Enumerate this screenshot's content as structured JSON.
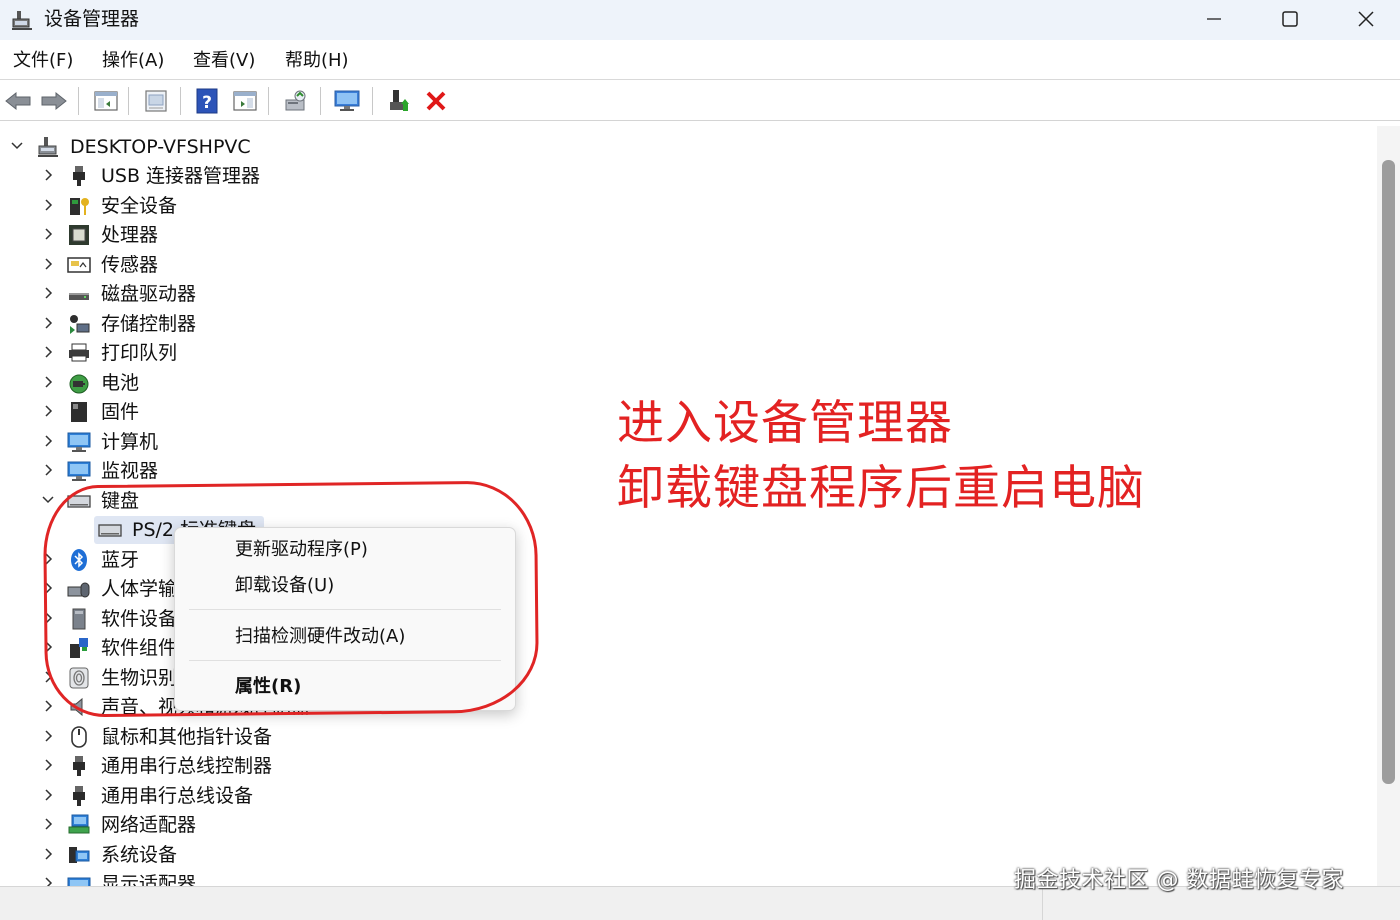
{
  "window": {
    "title": "设备管理器"
  },
  "menu": [
    {
      "label": "文件(F)"
    },
    {
      "label": "操作(A)"
    },
    {
      "label": "查看(V)"
    },
    {
      "label": "帮助(H)"
    }
  ],
  "toolbar_icons": [
    "back-arrow-icon",
    "forward-arrow-icon",
    "show-hide-console-tree-icon",
    "properties-icon",
    "help-icon",
    "action-pane-icon",
    "scan-hardware-icon",
    "monitor-icon",
    "update-driver-icon",
    "uninstall-device-icon"
  ],
  "tree": {
    "root": {
      "label": "DESKTOP-VFSHPVC",
      "icon": "computer-tree-root-icon"
    },
    "categories": [
      {
        "label": "USB 连接器管理器",
        "icon": "usb-plug-icon"
      },
      {
        "label": "安全设备",
        "icon": "security-key-icon"
      },
      {
        "label": "处理器",
        "icon": "processor-chip-icon"
      },
      {
        "label": "传感器",
        "icon": "sensor-icon"
      },
      {
        "label": "磁盘驱动器",
        "icon": "disk-drive-icon"
      },
      {
        "label": "存储控制器",
        "icon": "storage-controller-icon"
      },
      {
        "label": "打印队列",
        "icon": "printer-icon"
      },
      {
        "label": "电池",
        "icon": "battery-icon"
      },
      {
        "label": "固件",
        "icon": "firmware-icon"
      },
      {
        "label": "计算机",
        "icon": "computer-monitor-icon"
      },
      {
        "label": "监视器",
        "icon": "display-monitor-icon"
      },
      {
        "label": "键盘",
        "icon": "keyboard-icon",
        "expanded": true
      },
      {
        "label": "PS/2 标准键盘",
        "icon": "keyboard-icon",
        "child": true,
        "selected": true
      },
      {
        "label": "蓝牙",
        "icon": "bluetooth-icon"
      },
      {
        "label": "人体学输入设备",
        "icon": "hid-icon"
      },
      {
        "label": "软件设备",
        "icon": "software-device-icon"
      },
      {
        "label": "软件组件",
        "icon": "software-component-icon"
      },
      {
        "label": "生物识别设备",
        "icon": "fingerprint-icon"
      },
      {
        "label": "声音、视频和游戏控制器",
        "icon": "speaker-icon"
      },
      {
        "label": "鼠标和其他指针设备",
        "icon": "mouse-icon"
      },
      {
        "label": "通用串行总线控制器",
        "icon": "usb-plug-icon"
      },
      {
        "label": "通用串行总线设备",
        "icon": "usb-plug-icon"
      },
      {
        "label": "网络适配器",
        "icon": "network-adapter-icon"
      },
      {
        "label": "系统设备",
        "icon": "system-device-icon"
      },
      {
        "label": "显示适配器",
        "icon": "display-adapter-icon"
      }
    ]
  },
  "context_menu": {
    "items": [
      {
        "label": "更新驱动程序(P)"
      },
      {
        "label": "卸载设备(U)"
      },
      {
        "label": "扫描检测硬件改动(A)"
      },
      {
        "label": "属性(R)"
      }
    ]
  },
  "annotation": {
    "line1": "进入设备管理器",
    "line2": "卸载键盘程序后重启电脑",
    "color": "#e32222"
  },
  "watermark": "掘金技术社区 @ 数据蛙恢复专家"
}
